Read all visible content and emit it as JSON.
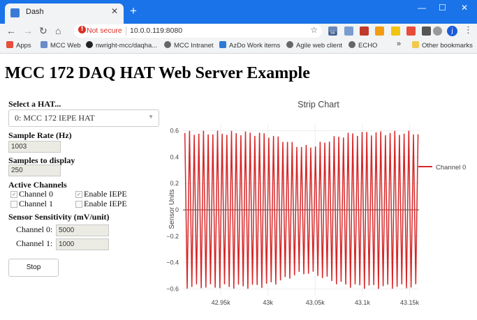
{
  "browser": {
    "tab_title": "Dash",
    "tab_close": "✕",
    "new_tab": "+",
    "window_controls": [
      "—",
      "☐",
      "✕"
    ],
    "security_label": "Not secure",
    "url": "10.0.0.119:8080",
    "extension_badge": "56",
    "profile_initial": "j",
    "nav": {
      "back": "←",
      "forward": "→",
      "reload": "↻",
      "home": "⌂"
    },
    "bookmarks": [
      "Apps",
      "MCC Web",
      "nwright-mcc/daqha...",
      "MCC Intranet",
      "AzDo Work items",
      "Agile web client",
      "ECHO"
    ],
    "bookmarks_overflow": "»",
    "other_bookmarks": "Other bookmarks"
  },
  "page": {
    "title": "MCC 172 DAQ HAT Web Server Example",
    "hat_label": "Select a HAT...",
    "hat_selected": "0: MCC 172 IEPE HAT",
    "sample_rate_label": "Sample Rate (Hz)",
    "sample_rate_value": "1003",
    "samples_label": "Samples to display",
    "samples_value": "250",
    "active_channels_label": "Active Channels",
    "channel0_label": "Channel 0",
    "channel1_label": "Channel 1",
    "enable_iepe_label": "Enable IEPE",
    "channel0_checked": true,
    "channel1_checked": false,
    "iepe0_checked": true,
    "iepe1_checked": false,
    "sensitivity_label": "Sensor Sensitivity (mV/unit)",
    "sens_ch0_label": "Channel 0:",
    "sens_ch0_value": "5000",
    "sens_ch1_label": "Channel 1:",
    "sens_ch1_value": "1000",
    "stop_label": "Stop"
  },
  "chart_data": {
    "type": "line",
    "title": "Strip Chart",
    "ylabel": "Sensor Units",
    "xlabel": "",
    "xlim": [
      42910,
      43160
    ],
    "ylim": [
      -0.65,
      0.65
    ],
    "x_tick_values": [
      42950,
      43000,
      43050,
      43100,
      43150
    ],
    "x_tick_labels": [
      "42.95k",
      "43k",
      "43.05k",
      "43.1k",
      "43.15k"
    ],
    "y_tick_values": [
      0.6,
      0.4,
      0.2,
      0,
      -0.2,
      -0.4,
      -0.6
    ],
    "y_tick_labels": [
      "0.6",
      "0.4",
      "0.2",
      "0",
      "−0.2",
      "−0.4",
      "−0.6"
    ],
    "legend": "top-right",
    "series": [
      {
        "name": "Channel 0",
        "color": "#d62728",
        "x_start": 42912,
        "x_end": 43159,
        "cycles": 50,
        "amplitude": 0.6
      }
    ]
  },
  "colors": {
    "chrome_blue": "#1a73e8",
    "toolbar_gray": "#f1f3f4",
    "warning_red": "#d93025",
    "series_red": "#d62728"
  }
}
